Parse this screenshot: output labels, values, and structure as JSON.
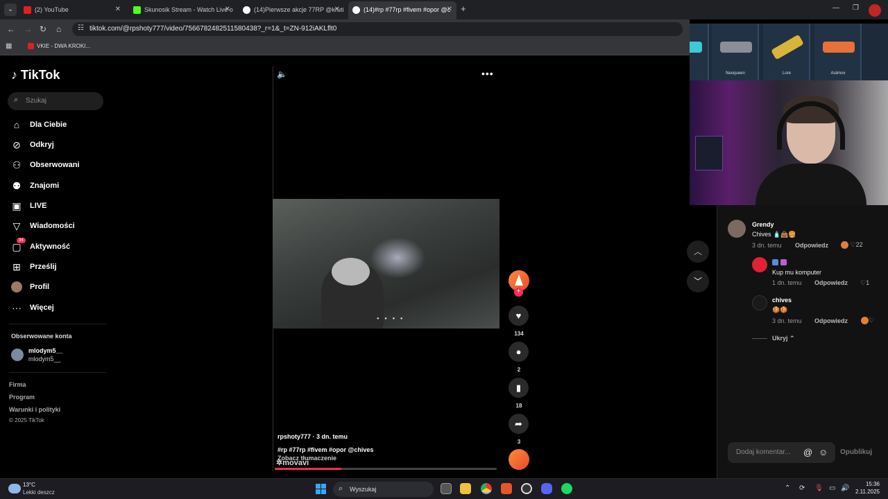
{
  "browser": {
    "tabs": [
      {
        "label": "(2) YouTube",
        "color": "#e02020"
      },
      {
        "label": "Skunosik Stream - Watch Live o",
        "color": "#53fc18"
      },
      {
        "label": "(14)Pierwsze akcje 77RP @kruti",
        "color": "#ffffff"
      },
      {
        "label": "(14)#rp #77rp #fivem #opor @c",
        "color": "#ffffff"
      }
    ],
    "url": "tiktok.com/@rpshoty777/video/7566782482511580438?_r=1&_t=ZN-912iAKLflt0",
    "bookmark": "VKIE - DWA KROKI..."
  },
  "tiktok": {
    "logo": "TikTok",
    "search_placeholder": "Szukaj",
    "nav": [
      {
        "label": "Dla Ciebie",
        "icon": "home-icon"
      },
      {
        "label": "Odkryj",
        "icon": "compass-icon"
      },
      {
        "label": "Obserwowani",
        "icon": "following-icon"
      },
      {
        "label": "Znajomi",
        "icon": "friends-icon"
      },
      {
        "label": "LIVE",
        "icon": "live-icon"
      },
      {
        "label": "Wiadomości",
        "icon": "messages-icon"
      },
      {
        "label": "Aktywność",
        "icon": "activity-icon",
        "badge": "34"
      },
      {
        "label": "Prześlij",
        "icon": "upload-icon"
      },
      {
        "label": "Profil",
        "icon": "profile-icon"
      },
      {
        "label": "Więcej",
        "icon": "more-icon"
      }
    ],
    "followed_title": "Obserwowane konta",
    "followed_account": {
      "name": "mlodym5__",
      "handle": "mlodym5__"
    },
    "footer": [
      "Firma",
      "Program",
      "Warunki i polityki",
      "© 2025 TikTok"
    ]
  },
  "video": {
    "author_line": "rpshoty777 · 3 dn. temu",
    "tags": "#rp #77rp #fivem #opor @chives",
    "translate": "Zobacz tłumaczenie",
    "watermark": "movavi",
    "progress": 0.3,
    "likes": "134",
    "comments": "2",
    "saves": "18",
    "shares": "3"
  },
  "overlay": {
    "skins": [
      "",
      "Neoqueen",
      "Lore",
      "Asiimov"
    ]
  },
  "comments": [
    {
      "name": "Grendy",
      "text": "Chives 🧴👜🍔",
      "time": "3 dn. temu",
      "reply": "Odpowiedz",
      "likes": "22"
    },
    {
      "name": "",
      "text": "Kup mu komputer",
      "time": "1 dn. temu",
      "reply": "Odpowiedz",
      "likes": "1"
    },
    {
      "name": "chives",
      "text": "🍪🍪",
      "time": "3 dn. temu",
      "reply": "Odpowiedz",
      "likes": ""
    }
  ],
  "comments_hide": "Ukryj",
  "comment_input_placeholder": "Dodaj komentar...",
  "post_label": "Opublikuj",
  "taskbar": {
    "temp": "13°C",
    "weather": "Lekki deszcz",
    "search": "Wyszukaj",
    "time": "15:36",
    "date": "2.11.2025"
  }
}
